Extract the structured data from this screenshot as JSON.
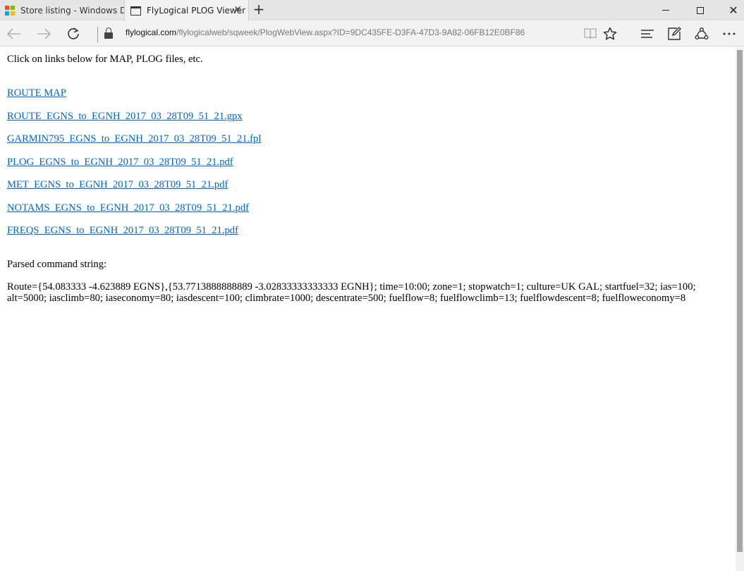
{
  "tabs": [
    {
      "title": "Store listing - Windows Dev",
      "active": false,
      "icon": "microsoft-logo-icon"
    },
    {
      "title": "FlyLogical PLOG Viewer",
      "active": true,
      "icon": "page-icon"
    }
  ],
  "address_bar": {
    "host": "flylogical.com",
    "path": "/flylogicalweb/sqweek/PlogWebView.aspx?ID=9DC435FE-D3FA-47D3-9A82-06FB12E0BF86"
  },
  "page": {
    "intro": "Click on links below for MAP, PLOG files, etc.",
    "links": [
      "ROUTE MAP",
      "ROUTE_EGNS_to_EGNH_2017_03_28T09_51_21.gpx",
      "GARMIN795_EGNS_to_EGNH_2017_03_28T09_51_21.fpl",
      "PLOG_EGNS_to_EGNH_2017_03_28T09_51_21.pdf",
      "MET_EGNS_to_EGNH_2017_03_28T09_51_21.pdf",
      "NOTAMS_EGNS_to_EGNH_2017_03_28T09_51_21.pdf",
      "FREQS_EGNS_to_EGNH_2017_03_28T09_51_21.pdf"
    ],
    "parsed_label": "Parsed command string:",
    "parsed_text": "Route={54.083333 -4.623889 EGNS},{53.7713888888889 -3.02833333333333 EGNH}; time=10:00; zone=1; stopwatch=1; culture=UK GAL; startfuel=32; ias=100; alt=5000; iasclimb=80; iaseconomy=80; iasdescent=100; climbrate=1000; descentrate=500; fuelflow=8; fuelflowclimb=13; fuelflowdescent=8; fuelfloweconomy=8"
  },
  "colors": {
    "link": "#0563c1",
    "chrome": "#f2f2f2",
    "tabstrip": "#e6e6e6"
  }
}
